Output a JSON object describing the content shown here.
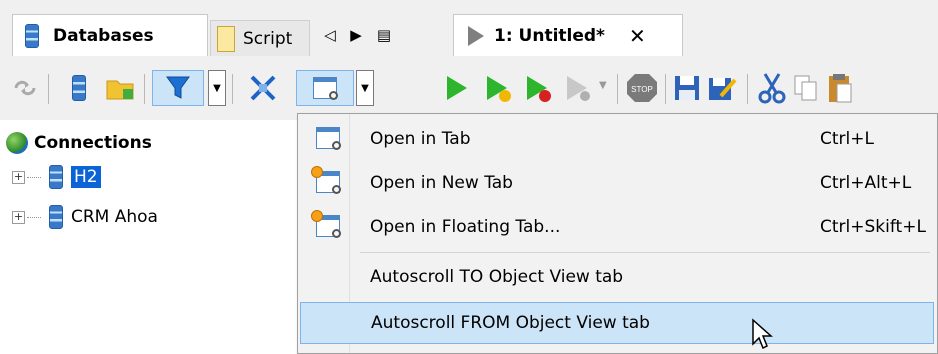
{
  "left": {
    "tabs": [
      {
        "label": "Databases",
        "active": true
      },
      {
        "label": "Script",
        "active": false
      }
    ],
    "tab_nav": {
      "prev": "◁",
      "next": "▶",
      "list": "▤"
    },
    "tree": {
      "root_label": "Connections",
      "items": [
        {
          "label": "H2",
          "selected": true,
          "expander": "+"
        },
        {
          "label": "CRM Ahoa",
          "selected": false,
          "expander": "+"
        }
      ]
    }
  },
  "right": {
    "tab": {
      "label": "1: Untitled*",
      "close": "✕"
    }
  },
  "menu": {
    "items": [
      {
        "label": "Open in Tab",
        "shortcut": "Ctrl+L",
        "icon": "open-tab-icon"
      },
      {
        "label": "Open in New Tab",
        "shortcut": "Ctrl+Alt+L",
        "icon": "open-new-tab-icon"
      },
      {
        "label": "Open in Floating Tab...",
        "shortcut": "Ctrl+Skift+L",
        "icon": "open-floating-tab-icon"
      },
      {
        "label": "Autoscroll TO Object View tab",
        "shortcut": ""
      },
      {
        "label": "Autoscroll FROM Object View tab",
        "shortcut": "",
        "hovered": true
      }
    ]
  },
  "colors": {
    "selection": "#0a64d6",
    "hover_bg": "#cce4f7",
    "hover_border": "#7eb4ea",
    "run_green": "#2db52d",
    "stop_red": "#d82020"
  }
}
